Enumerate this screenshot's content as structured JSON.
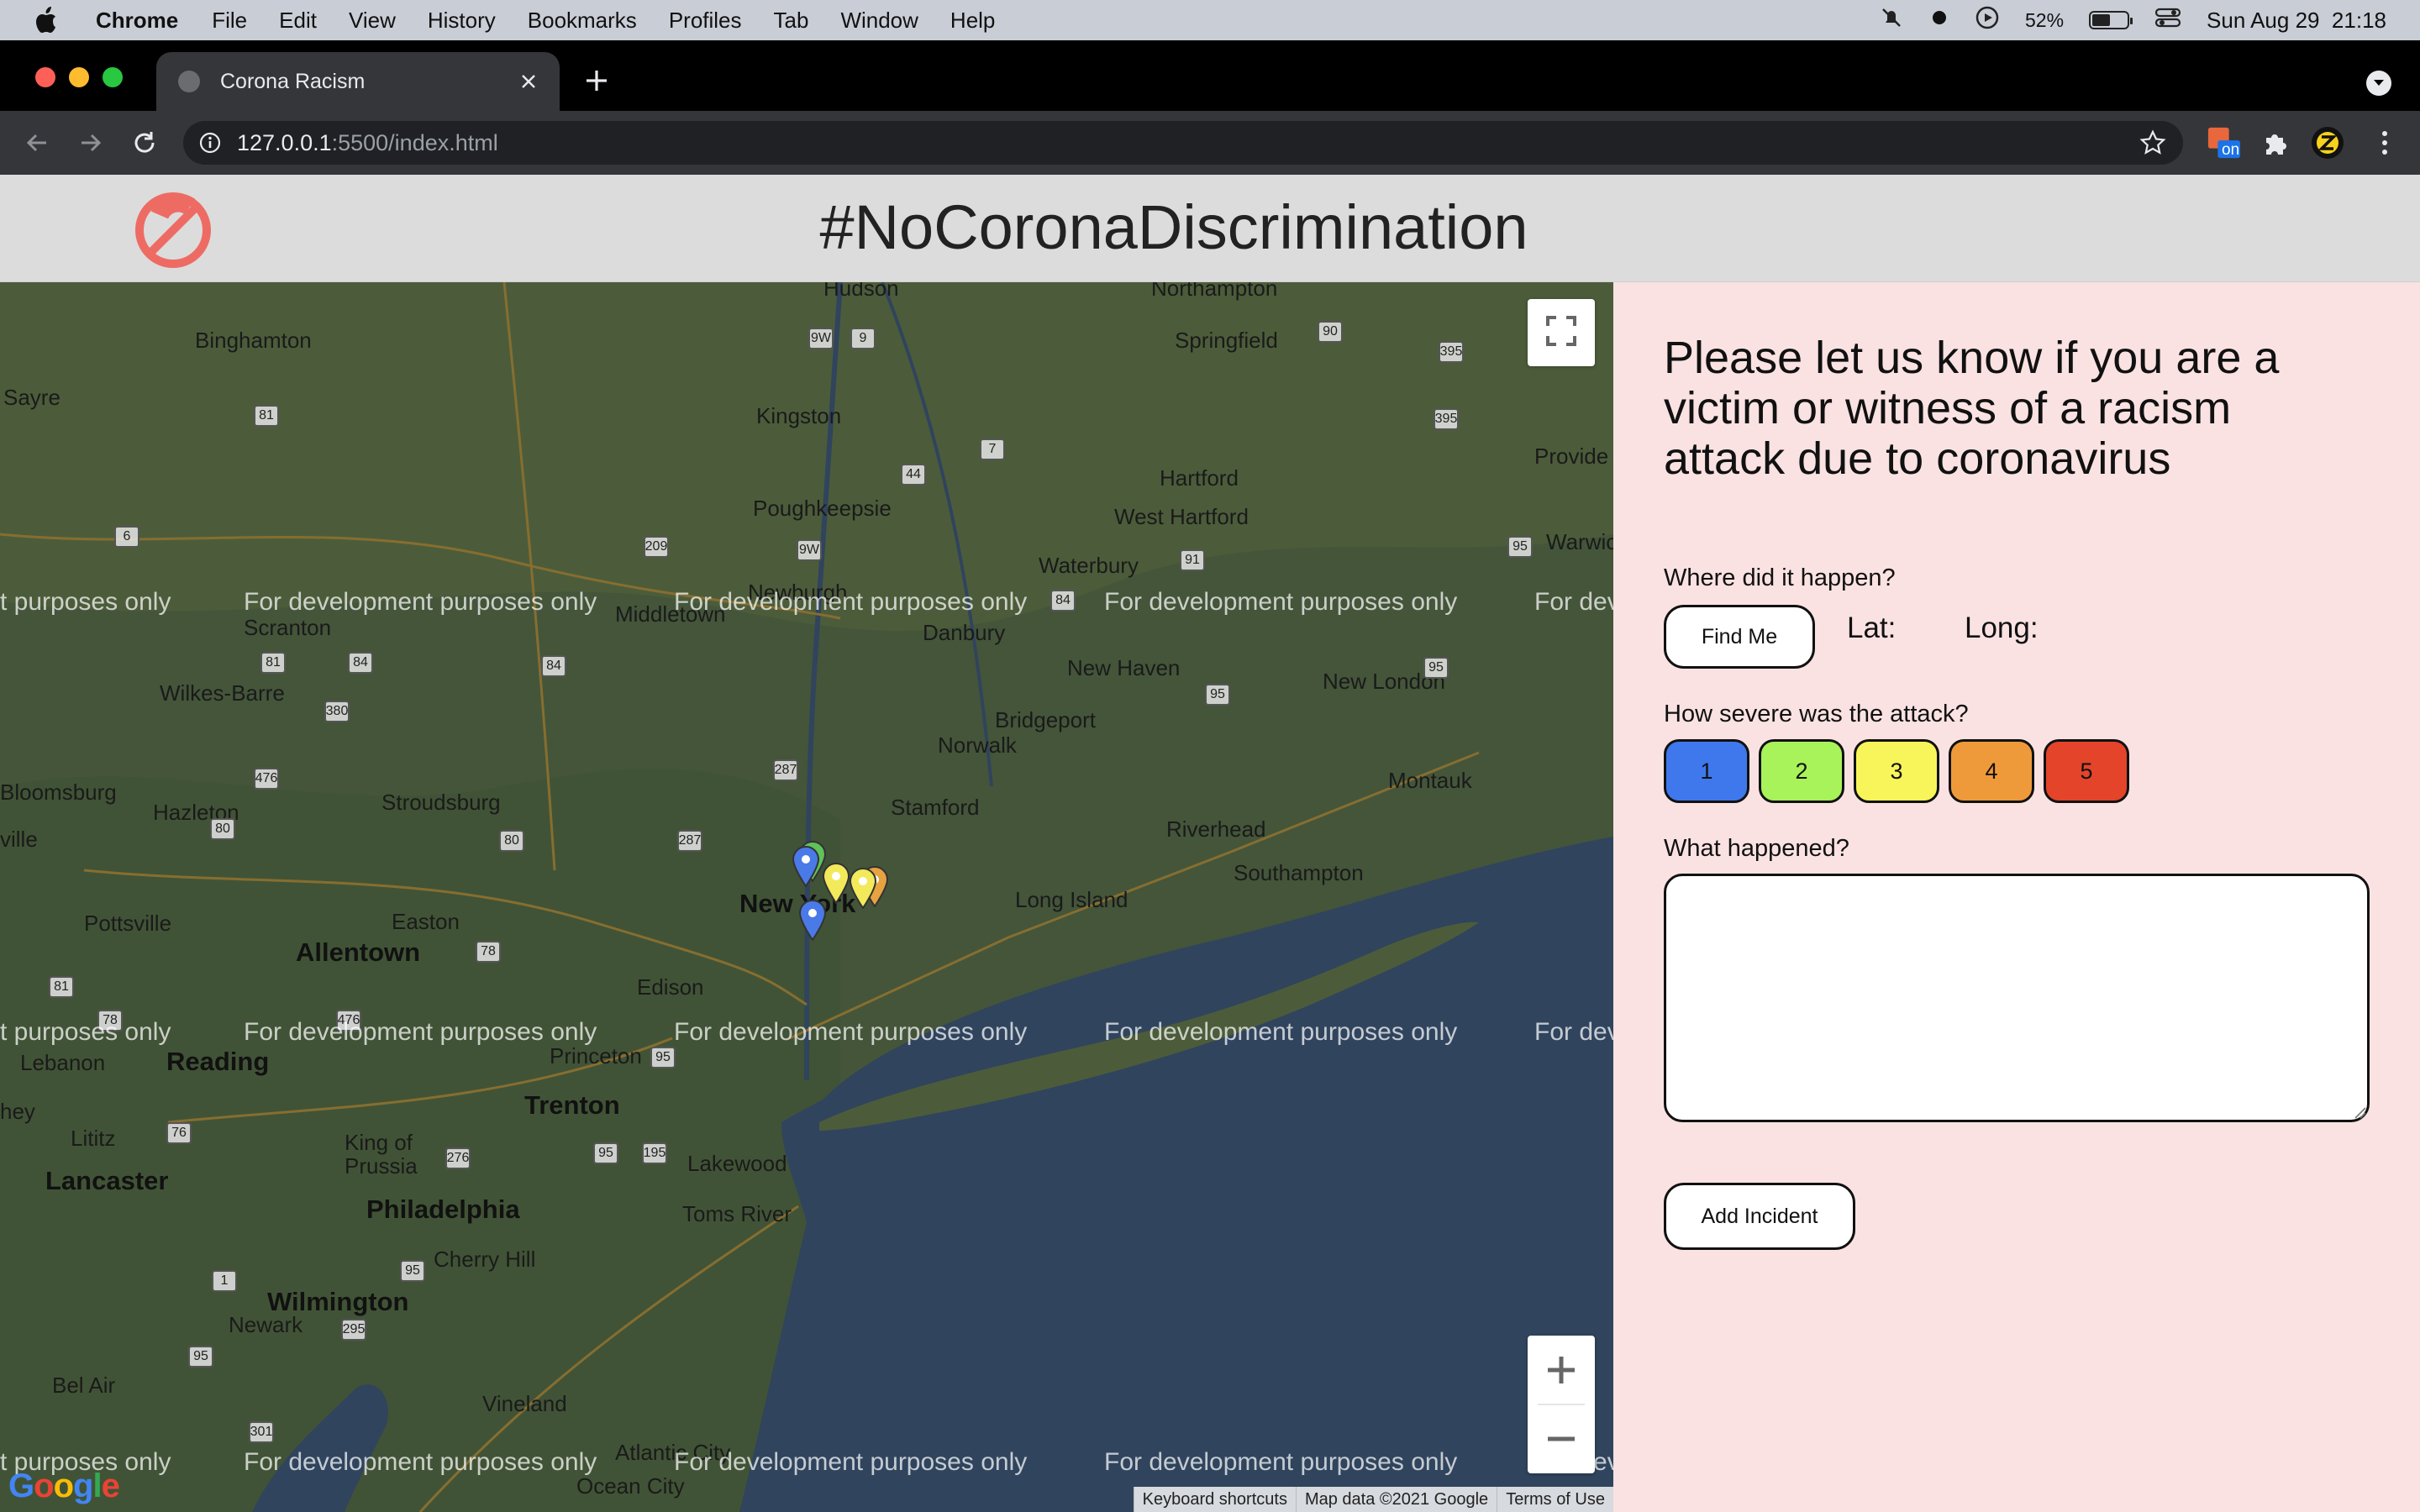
{
  "menubar": {
    "app_name": "Chrome",
    "items": [
      "File",
      "Edit",
      "View",
      "History",
      "Bookmarks",
      "Profiles",
      "Tab",
      "Window",
      "Help"
    ],
    "battery_percent": "52%",
    "battery_level": 0.52,
    "clock": "Sun Aug 29  21:18"
  },
  "browser": {
    "tab_title": "Corona Racism",
    "url_host": "127.0.0.1",
    "url_rest": ":5500/index.html",
    "extension_badge": "on",
    "colors": {
      "tabstrip": "#000000",
      "toolbar": "#35363a",
      "omnibox": "#202124"
    }
  },
  "site": {
    "title": "#NoCoronaDiscrimination",
    "header_color": "#dcdcdc",
    "logo_color": "#ee6b64"
  },
  "map": {
    "watermark": "For development purposes only",
    "watermark_partial_left": "t purposes only",
    "watermark_partial_right": "For dev",
    "fullscreen_icon": "fullscreen-icon",
    "zoom_in": "+",
    "zoom_out": "−",
    "attribution": {
      "shortcuts": "Keyboard shortcuts",
      "data": "Map data ©2021 Google",
      "terms": "Terms of Use"
    },
    "provider_logo": "Google",
    "places": {
      "binghamton": "Binghamton",
      "sayre": "Sayre",
      "kingston": "Kingston",
      "hudson": "Hudson",
      "northampton": "Northampton",
      "springfield": "Springfield",
      "poughkeepsie": "Poughkeepsie",
      "hartford": "Hartford",
      "west_hartford": "West Hartford",
      "providence": "Provide",
      "warwick": "Warwic",
      "waterbury": "Waterbury",
      "newburgh": "Newburgh",
      "middletown": "Middletown",
      "scranton": "Scranton",
      "danbury": "Danbury",
      "new_haven": "New Haven",
      "new_london": "New London",
      "wilkes_barre": "Wilkes-Barre",
      "bridgeport": "Bridgeport",
      "norwalk": "Norwalk",
      "montauk": "Montauk",
      "bloomsburg": "Bloomsburg",
      "stroudsburg": "Stroudsburg",
      "hazleton": "Hazleton",
      "stamford": "Stamford",
      "riverhead": "Riverhead",
      "ville": "ville",
      "new_york": "New York",
      "long_island": "Long Island",
      "southampton": "Southampton",
      "pottsville": "Pottsville",
      "easton": "Easton",
      "allentown": "Allentown",
      "edison": "Edison",
      "lebanon": "Lebanon",
      "reading": "Reading",
      "princeton": "Princeton",
      "trenton": "Trenton",
      "hey": "hey",
      "lititz": "Lititz",
      "king_of_prussia": "King of\nPrussia",
      "lakewood": "Lakewood",
      "lancaster": "Lancaster",
      "philadelphia": "Philadelphia",
      "toms_river": "Toms River",
      "cherry_hill": "Cherry Hill",
      "wilmington": "Wilmington",
      "newark_de": "Newark",
      "vineland": "Vineland",
      "bel_air": "Bel Air",
      "atlantic_city": "Atlantic City",
      "ocean_city": "Ocean City"
    },
    "shields": [
      "9W",
      "9",
      "81",
      "44",
      "7",
      "395",
      "90",
      "6",
      "209",
      "9W",
      "91",
      "395",
      "95",
      "84",
      "81",
      "84",
      "84",
      "380",
      "95",
      "95",
      "287",
      "476",
      "80",
      "80",
      "287",
      "78",
      "476",
      "81",
      "78",
      "95",
      "76",
      "276",
      "95",
      "195",
      "1",
      "95",
      "295",
      "95",
      "301"
    ],
    "markers": [
      {
        "color": "#4a7ae8"
      },
      {
        "color": "#5fc25a"
      },
      {
        "color": "#f2ea5a"
      },
      {
        "color": "#f2ea5a"
      },
      {
        "color": "#e7a340"
      },
      {
        "color": "#4a7ae8"
      }
    ]
  },
  "form": {
    "prompt": "Please let us know if you are a victim or witness of a racism attack due to coronavirus",
    "where_label": "Where did it happen?",
    "find_me": "Find Me",
    "lat_label": "Lat:",
    "long_label": "Long:",
    "severity_label": "How severe was the attack?",
    "severity": [
      {
        "label": "1",
        "color": "#3f78ec"
      },
      {
        "label": "2",
        "color": "#a8f25a"
      },
      {
        "label": "3",
        "color": "#f7f55a"
      },
      {
        "label": "4",
        "color": "#ef9a3a"
      },
      {
        "label": "5",
        "color": "#e4442a"
      }
    ],
    "what_label": "What happened?",
    "description_value": "",
    "add_incident": "Add Incident",
    "panel_color": "#fbe2e2"
  }
}
